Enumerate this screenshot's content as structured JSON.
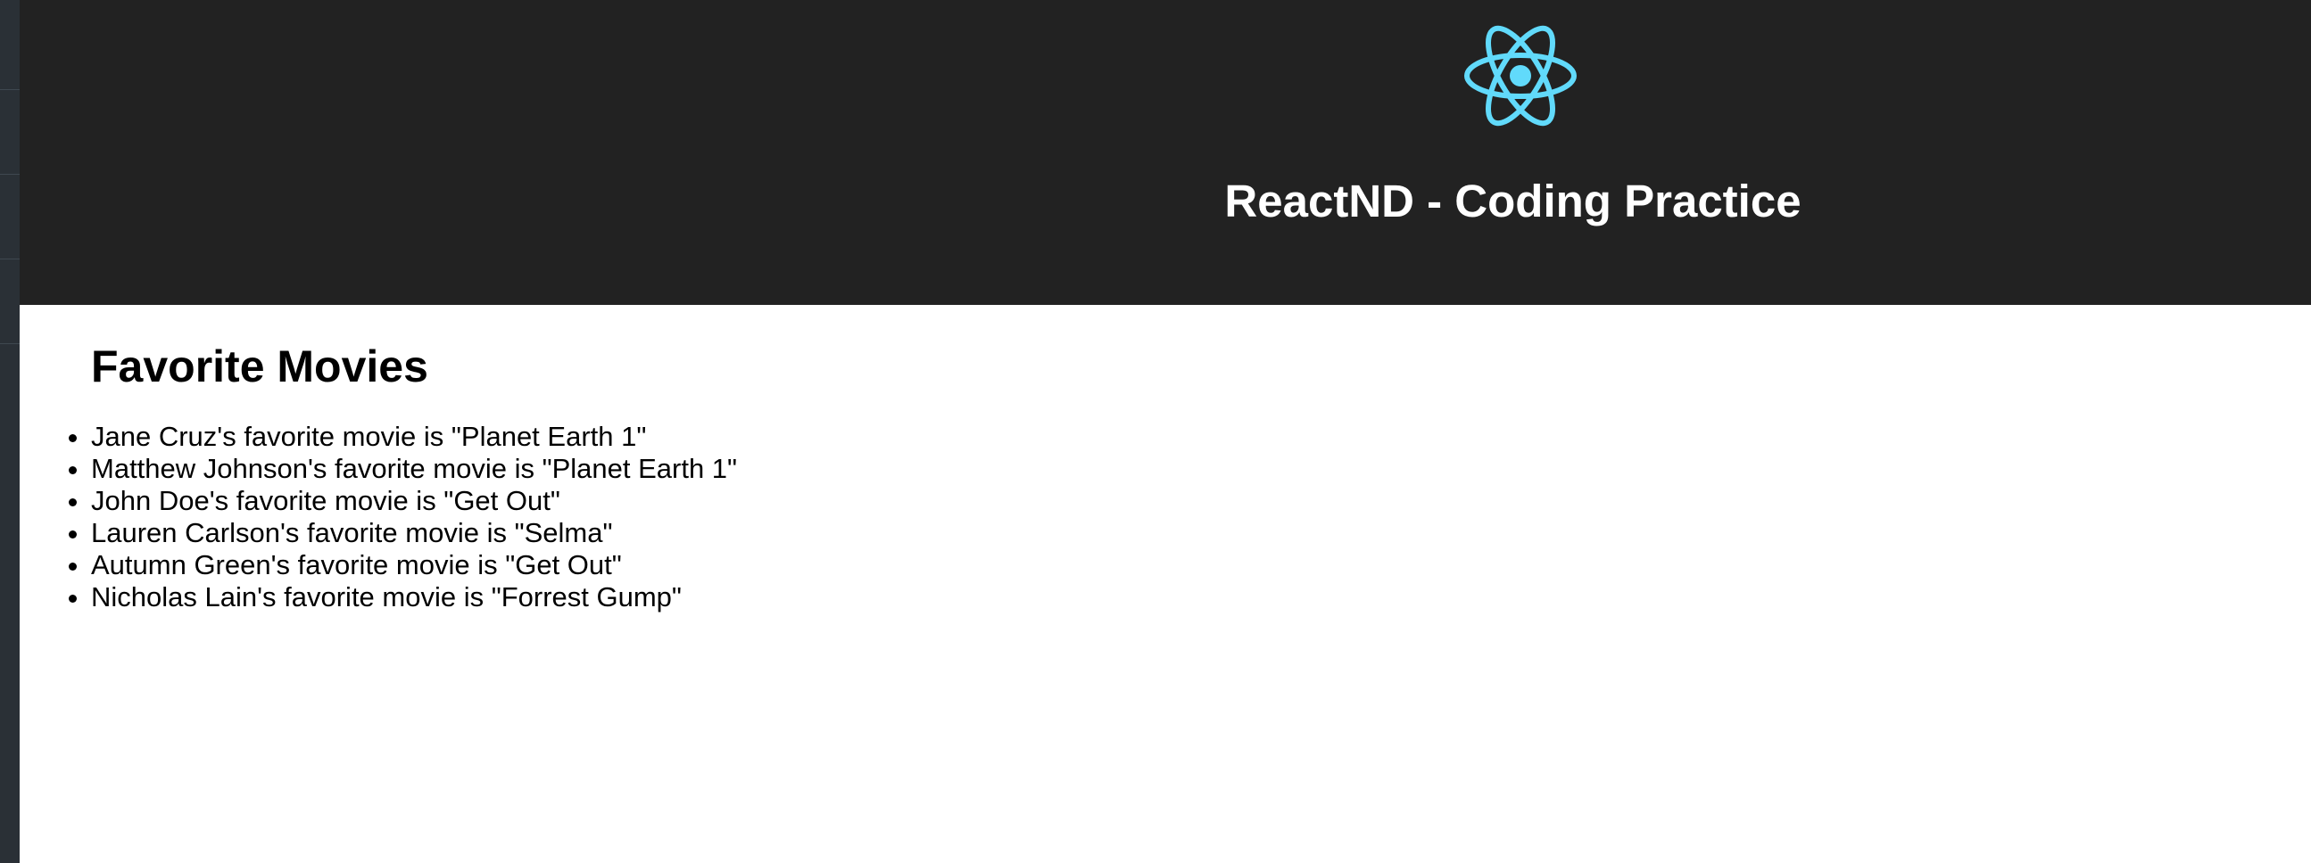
{
  "header": {
    "logo_icon": "react-atom-logo-icon",
    "title": "ReactND - Coding Practice",
    "background_color": "#222222",
    "logo_color": "#61dafb"
  },
  "main": {
    "heading": "Favorite Movies",
    "items": [
      "Jane Cruz's favorite movie is \"Planet Earth 1\"",
      "Matthew Johnson's favorite movie is \"Planet Earth 1\"",
      "John Doe's favorite movie is \"Get Out\"",
      "Lauren Carlson's favorite movie is \"Selma\"",
      "Autumn Green's favorite movie is \"Get Out\"",
      "Nicholas Lain's favorite movie is \"Forrest Gump\""
    ]
  }
}
